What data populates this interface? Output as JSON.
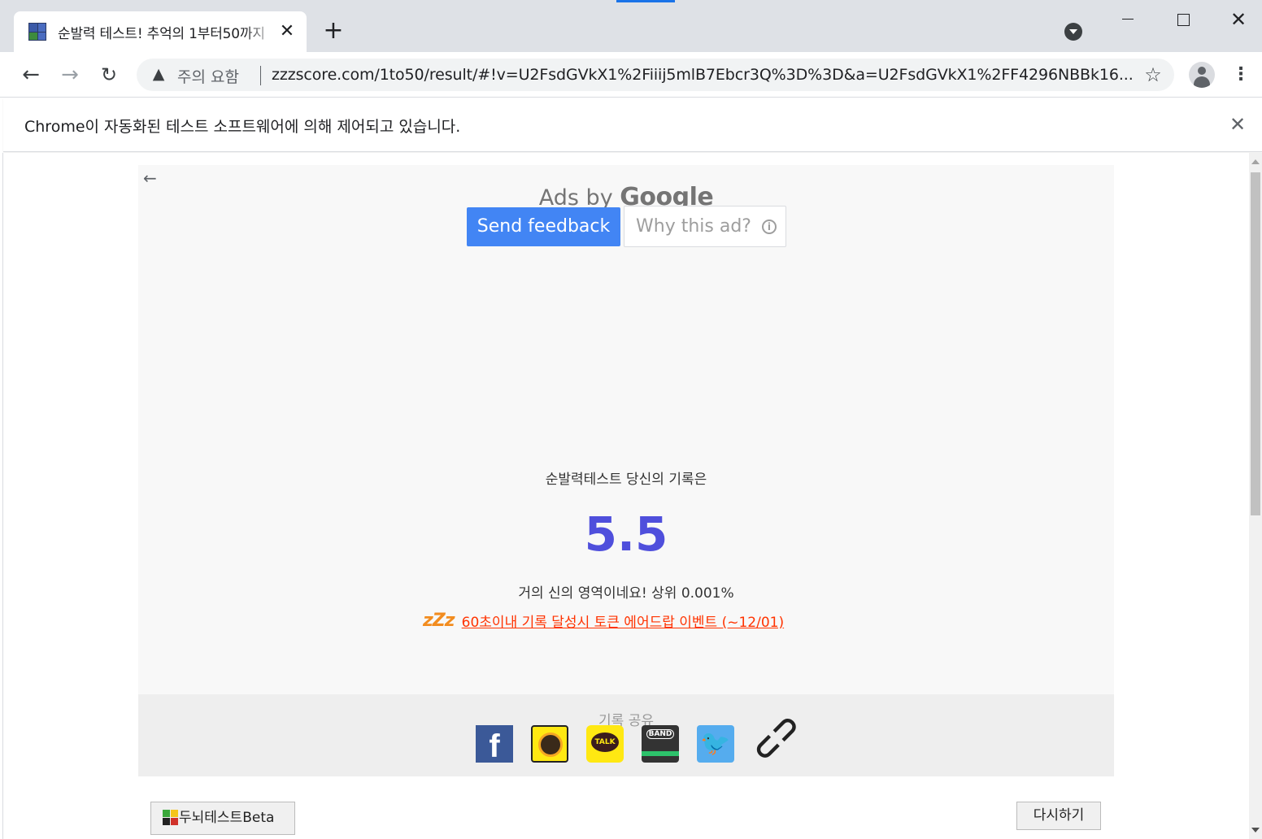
{
  "browser": {
    "tab": {
      "title": "순발력 테스트! 추억의 1부터50까지",
      "close_glyph": "✕"
    },
    "new_tab_glyph": "+",
    "window_controls": {
      "minimize": "",
      "maximize": "",
      "close": "✕"
    },
    "nav": {
      "back": "←",
      "forward": "→",
      "reload": "↻"
    },
    "address_bar": {
      "security_icon": "warning-icon",
      "security_text": "주의 요함",
      "url": "zzzscore.com/1to50/result/#!v=U2FsdGVkX1%2Fiiij5mlB7Ebcr3Q%3D%3D&a=U2FsdGVkX1%2FF4296NBBk16..."
    },
    "star_glyph": "☆",
    "menu_glyph": "⋮"
  },
  "infobar": {
    "message": "Chrome이 자동화된 테스트 소프트웨어에 의해 제어되고 있습니다.",
    "close_glyph": "✕"
  },
  "ad": {
    "back_glyph": "←",
    "ads_by": "Ads by",
    "google": "Google",
    "send_feedback": "Send feedback",
    "why_this_ad": "Why this ad?",
    "info_glyph": "i"
  },
  "result": {
    "label": "순발력테스트 당신의 기록은",
    "score": "5.5",
    "message": "거의 신의 영역이네요! 상위 0.001%",
    "event_logo": "zZz",
    "event_link": "60초이내 기록 달성시 토큰 에어드랍 이벤트 (~12/01)"
  },
  "share": {
    "label": "기록 공유",
    "icons": {
      "facebook": "f",
      "kakaostory": "",
      "kakaotalk": "TALK",
      "band": "BAND",
      "twitter": "🐦",
      "link": "🔗"
    }
  },
  "footer": {
    "brain_test": "두뇌테스트Beta",
    "retry": "다시하기"
  },
  "colors": {
    "score": "#4f4fdc",
    "feedback_button": "#4285f4",
    "event_link": "#ff3300"
  }
}
